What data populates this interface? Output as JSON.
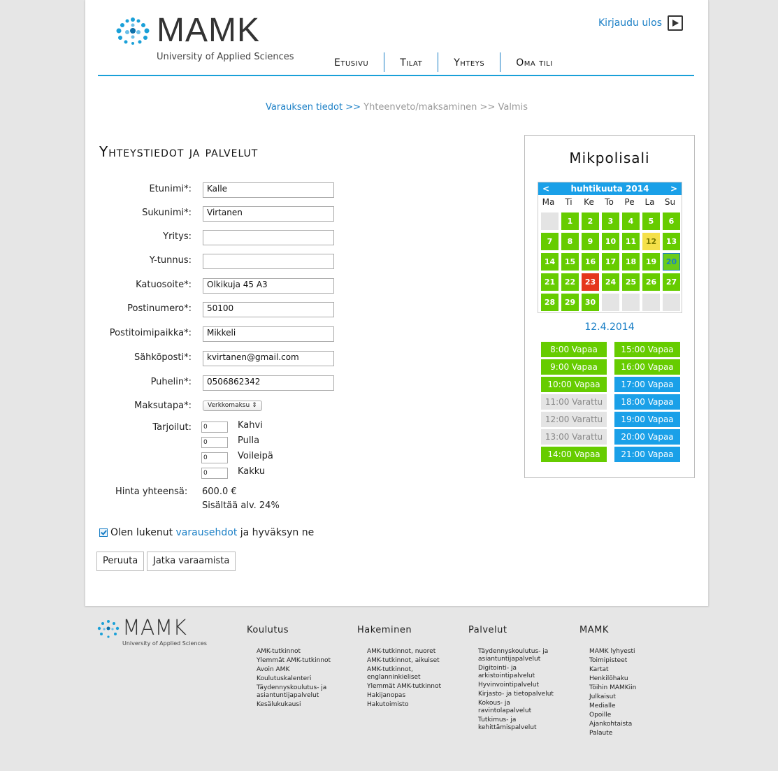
{
  "header": {
    "logo_text": "MAMK",
    "logo_sub": "University of Applied Sciences",
    "logout_label": "Kirjaudu ulos",
    "nav": [
      {
        "label": "Etusivu"
      },
      {
        "label": "Tilat"
      },
      {
        "label": "Yhteys"
      },
      {
        "label": "Oma tili"
      }
    ]
  },
  "breadcrumb": {
    "active": "Varauksen tiedot >>",
    "rest": " Yhteenveto/maksaminen >> Valmis"
  },
  "form": {
    "title": "Yhteystiedot ja palvelut",
    "fields": [
      {
        "label": "Etunimi*:",
        "value": "Kalle"
      },
      {
        "label": "Sukunimi*:",
        "value": "Virtanen"
      },
      {
        "label": "Yritys:",
        "value": ""
      },
      {
        "label": "Y-tunnus:",
        "value": ""
      },
      {
        "label": "Katuosoite*:",
        "value": "Olkikuja 45 A3"
      },
      {
        "label": "Postinumero*:",
        "value": "50100"
      },
      {
        "label": "Postitoimipaikka*:",
        "value": "Mikkeli"
      },
      {
        "label": "Sähköposti*:",
        "value": "kvirtanen@gmail.com"
      },
      {
        "label": "Puhelin*:",
        "value": "0506862342"
      }
    ],
    "payment_label": "Maksutapa*:",
    "payment_value": "Verkkomaksu",
    "services_label": "Tarjoilut:",
    "services": [
      {
        "qty": "0",
        "name": "Kahvi"
      },
      {
        "qty": "0",
        "name": "Pulla"
      },
      {
        "qty": "0",
        "name": "Voileipä"
      },
      {
        "qty": "0",
        "name": "Kakku"
      }
    ],
    "price_label": "Hinta yhteensä:",
    "price_value": "600.0 €",
    "price_vat": "Sisältää alv. 24%",
    "accept_pre": "Olen lukenut ",
    "accept_link": "varausehdot",
    "accept_post": " ja hyväksyn ne",
    "cancel_label": "Peruuta",
    "continue_label": "Jatka varaamista"
  },
  "calendar": {
    "room": "Mikpolisali",
    "prev": "<",
    "next": ">",
    "month": "huhtikuuta 2014",
    "dow": [
      "Ma",
      "Ti",
      "Ke",
      "To",
      "Pe",
      "La",
      "Su"
    ],
    "days": [
      {
        "n": "",
        "s": "empty"
      },
      {
        "n": "1",
        "s": "free"
      },
      {
        "n": "2",
        "s": "free"
      },
      {
        "n": "3",
        "s": "free"
      },
      {
        "n": "4",
        "s": "free"
      },
      {
        "n": "5",
        "s": "free"
      },
      {
        "n": "6",
        "s": "free"
      },
      {
        "n": "7",
        "s": "free"
      },
      {
        "n": "8",
        "s": "free"
      },
      {
        "n": "9",
        "s": "free"
      },
      {
        "n": "10",
        "s": "free"
      },
      {
        "n": "11",
        "s": "free"
      },
      {
        "n": "12",
        "s": "partial"
      },
      {
        "n": "13",
        "s": "free"
      },
      {
        "n": "14",
        "s": "free"
      },
      {
        "n": "15",
        "s": "free"
      },
      {
        "n": "16",
        "s": "free"
      },
      {
        "n": "17",
        "s": "free"
      },
      {
        "n": "18",
        "s": "free"
      },
      {
        "n": "19",
        "s": "free"
      },
      {
        "n": "20",
        "s": "today"
      },
      {
        "n": "21",
        "s": "free"
      },
      {
        "n": "22",
        "s": "free"
      },
      {
        "n": "23",
        "s": "full"
      },
      {
        "n": "24",
        "s": "free"
      },
      {
        "n": "25",
        "s": "free"
      },
      {
        "n": "26",
        "s": "free"
      },
      {
        "n": "27",
        "s": "free"
      },
      {
        "n": "28",
        "s": "free"
      },
      {
        "n": "29",
        "s": "free"
      },
      {
        "n": "30",
        "s": "free"
      },
      {
        "n": "",
        "s": "empty"
      },
      {
        "n": "",
        "s": "empty"
      },
      {
        "n": "",
        "s": "empty"
      },
      {
        "n": "",
        "s": "empty"
      }
    ],
    "selected_date": "12.4.2014",
    "slots_left": [
      {
        "label": "8:00 Vapaa",
        "s": "free"
      },
      {
        "label": "9:00 Vapaa",
        "s": "free"
      },
      {
        "label": "10:00 Vapaa",
        "s": "free"
      },
      {
        "label": "11:00 Varattu",
        "s": "booked"
      },
      {
        "label": "12:00 Varattu",
        "s": "booked"
      },
      {
        "label": "13:00 Varattu",
        "s": "booked"
      },
      {
        "label": "14:00 Vapaa",
        "s": "free"
      }
    ],
    "slots_right": [
      {
        "label": "15:00 Vapaa",
        "s": "free"
      },
      {
        "label": "16:00 Vapaa",
        "s": "free"
      },
      {
        "label": "17:00 Vapaa",
        "s": "evening"
      },
      {
        "label": "18:00 Vapaa",
        "s": "evening"
      },
      {
        "label": "19:00 Vapaa",
        "s": "evening"
      },
      {
        "label": "20:00 Vapaa",
        "s": "evening"
      },
      {
        "label": "21:00 Vapaa",
        "s": "evening"
      }
    ]
  },
  "footer": {
    "logo_text": "MAMK",
    "logo_sub": "University of Applied Sciences",
    "columns": [
      {
        "title": "Koulutus",
        "links": [
          "AMK-tutkinnot",
          "Ylemmät AMK-tutkinnot",
          "Avoin AMK",
          "Koulutuskalenteri",
          "Täydennyskoulutus- ja\nasiantuntijapalvelut",
          "Kesälukukausi"
        ]
      },
      {
        "title": "Hakeminen",
        "links": [
          "AMK-tutkinnot, nuoret",
          "AMK-tutkinnot, aikuiset",
          "AMK-tutkinnot,\nenglanninkieliset",
          "Ylemmät AMK-tutkinnot",
          "Hakijanopas",
          "Hakutoimisto"
        ]
      },
      {
        "title": "Palvelut",
        "links": [
          "Täydennyskoulutus- ja\nasiantuntijapalvelut",
          "Digitointi- ja\narkistointipalvelut",
          "Hyvinvointipalvelut",
          "Kirjasto- ja tietopalvelut",
          "Kokous- ja\nravintolapalvelut",
          "Tutkimus- ja\nkehittämispalvelut"
        ]
      },
      {
        "title": "MAMK",
        "links": [
          "MAMK lyhyesti",
          "Toimipisteet",
          "Kartat",
          "Henkilöhaku",
          "Töihin MAMKiin",
          "Julkaisut",
          "Medialle",
          "Opoille",
          "Ajankohtaista",
          "Palaute"
        ]
      }
    ]
  },
  "colors": {
    "accent": "#1a7fc6",
    "free": "#66cc00",
    "booked": "#e4e4e4",
    "evening": "#1aa0e8",
    "full": "#e5361c",
    "partial": "#f5e04a"
  }
}
